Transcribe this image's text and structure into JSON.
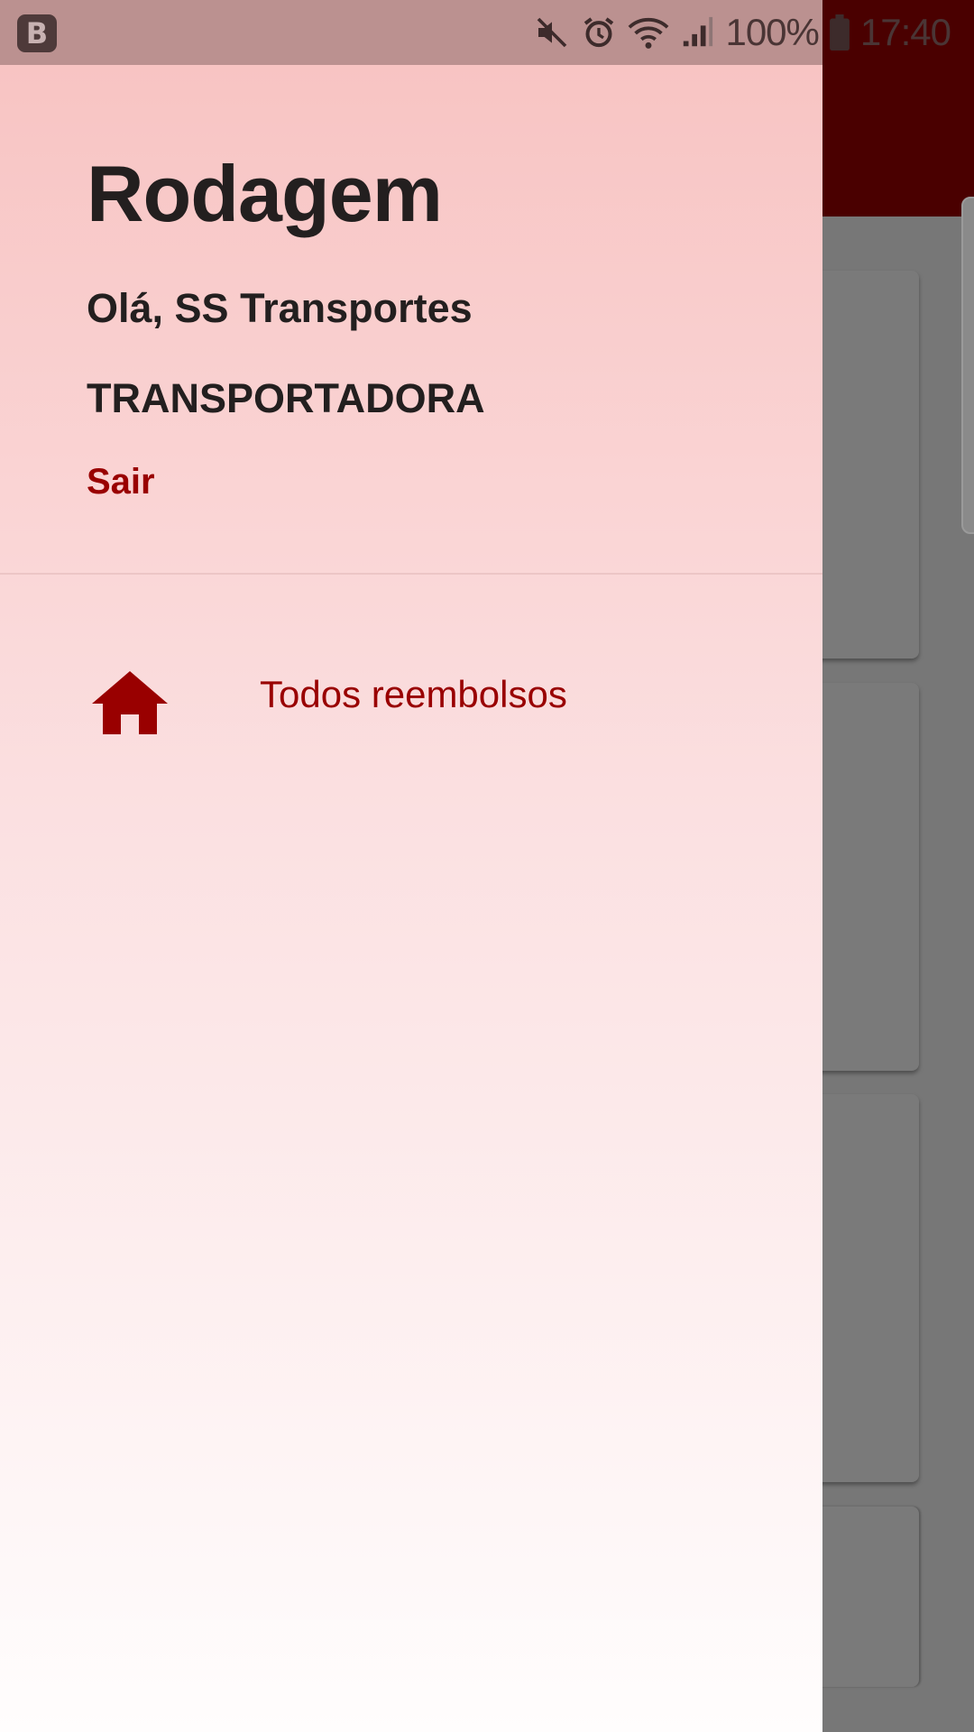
{
  "status_bar": {
    "app_badge": "B",
    "battery": "100%",
    "clock": "17:40",
    "icons": [
      "mute-icon",
      "alarm-icon",
      "wifi-icon",
      "signal-icon",
      "battery-icon"
    ]
  },
  "drawer": {
    "title": "Rodagem",
    "greeting": "Olá, SS Transportes",
    "role": "TRANSPORTADORA",
    "logout_label": "Sair",
    "items": [
      {
        "label": "Todos reembolsos",
        "icon": "home-icon"
      }
    ]
  },
  "colors": {
    "accent": "#990000",
    "app_bar": "#4a0000",
    "drawer_top": "#f8c4c3",
    "drawer_bottom": "#fffdfd",
    "text_dark": "#231f1f"
  }
}
